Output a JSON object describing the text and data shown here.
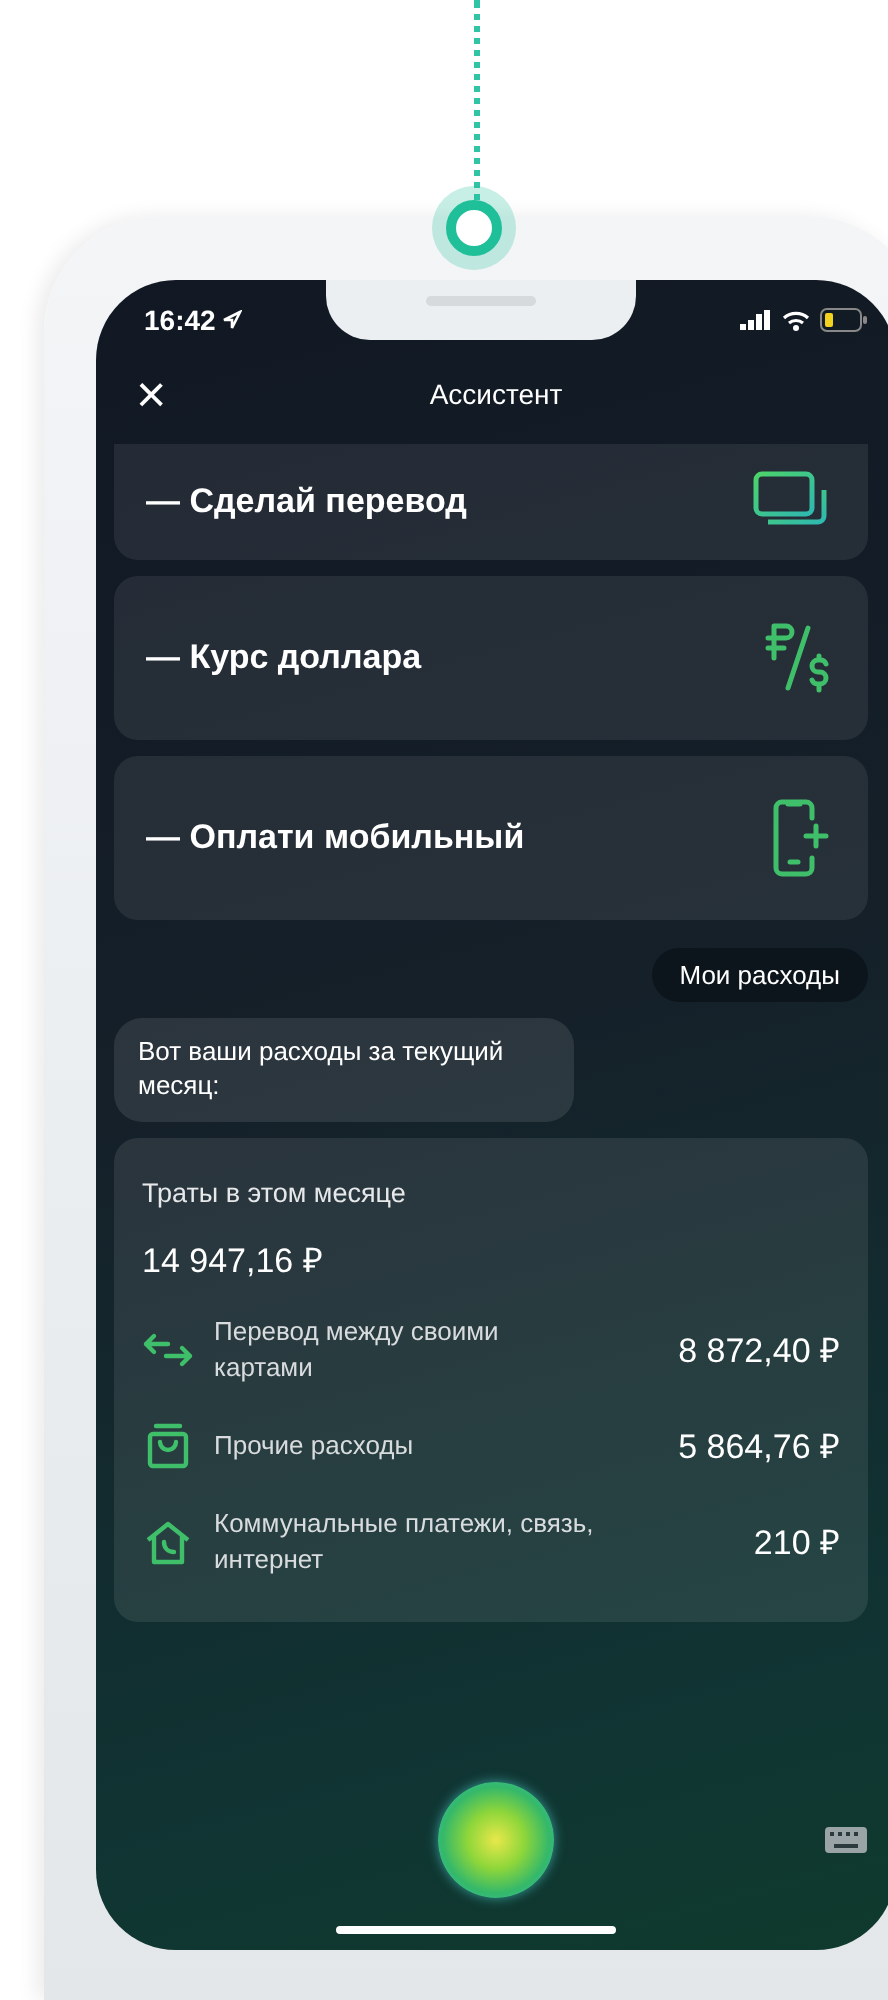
{
  "status_bar": {
    "time": "16:42"
  },
  "header": {
    "close": "×",
    "title": "Ассистент"
  },
  "suggestions": [
    {
      "label": "— Сделай перевод",
      "kind": "cards"
    },
    {
      "label": "— Курс доллара",
      "kind": "currency"
    },
    {
      "label": "— Оплати мобильный",
      "kind": "phone"
    }
  ],
  "messages": [
    {
      "kind": "user",
      "text": "Мои расходы"
    },
    {
      "kind": "bot",
      "text": "Вот ваши расходы за текущий месяц:"
    }
  ],
  "expenses": {
    "title": "Траты в этом месяце",
    "total": "14 947,16 ₽",
    "items": [
      {
        "kind": "transfer",
        "label": "Перевод между своими картами",
        "amount": "8 872,40 ₽"
      },
      {
        "kind": "bag",
        "label": "Прочие расходы",
        "amount": "5 864,76 ₽"
      },
      {
        "kind": "house",
        "label": "Коммунальные платежи, связь, интернет",
        "amount": "210 ₽"
      }
    ]
  }
}
